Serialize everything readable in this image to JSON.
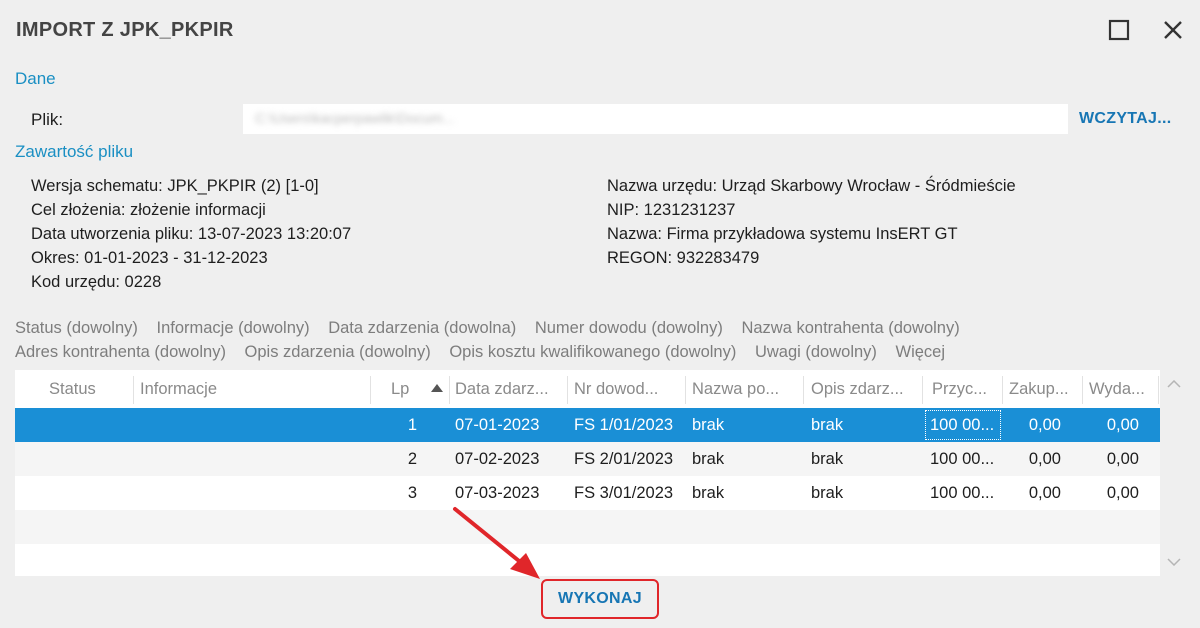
{
  "window": {
    "title": "IMPORT Z JPK_PKPIR",
    "maximize_icon": "maximize-icon",
    "close_icon": "close-icon"
  },
  "dane": {
    "section_label": "Dane",
    "plik_label": "Plik:",
    "plik_value": "C:\\Users\\kacperpawlik\\Docum...",
    "load_button": "WCZYTAJ..."
  },
  "contents": {
    "section_label": "Zawartość pliku",
    "left": [
      "Wersja schematu: JPK_PKPIR (2) [1-0]",
      "Cel złożenia: złożenie informacji",
      "Data utworzenia pliku: 13-07-2023 13:20:07",
      "Okres: 01-01-2023 - 31-12-2023",
      "Kod urzędu: 0228"
    ],
    "right": [
      "Nazwa urzędu: Urząd Skarbowy Wrocław - Śródmieście",
      "NIP: 1231231237",
      "Nazwa: Firma przykładowa systemu InsERT GT",
      "REGON: 932283479"
    ]
  },
  "filters": {
    "row1": [
      "Status (dowolny)",
      "Informacje (dowolny)",
      "Data zdarzenia (dowolna)",
      "Numer dowodu (dowolny)",
      "Nazwa kontrahenta (dowolny)"
    ],
    "row2": [
      "Adres kontrahenta (dowolny)",
      "Opis zdarzenia (dowolny)",
      "Opis kosztu kwalifikowanego (dowolny)",
      "Uwagi (dowolny)",
      "Więcej"
    ]
  },
  "grid": {
    "columns": [
      "Status",
      "Informacje",
      "Lp",
      "Data zdarz...",
      "Nr dowod...",
      "Nazwa po...",
      "Opis zdarz...",
      "Przyc...",
      "Zakup...",
      "Wyda..."
    ],
    "sort_icon": "sort-ascending-icon",
    "rows": [
      {
        "status": "",
        "info": "",
        "lp": "1",
        "data": "07-01-2023",
        "nr": "FS 1/01/2023",
        "nazwa": "brak",
        "opis": "brak",
        "przych": "100 00...",
        "zakup": "0,00",
        "wyd": "0,00",
        "selected": true
      },
      {
        "status": "",
        "info": "",
        "lp": "2",
        "data": "07-02-2023",
        "nr": "FS 2/01/2023",
        "nazwa": "brak",
        "opis": "brak",
        "przych": "100 00...",
        "zakup": "0,00",
        "wyd": "0,00",
        "selected": false
      },
      {
        "status": "",
        "info": "",
        "lp": "3",
        "data": "07-03-2023",
        "nr": "FS 3/01/2023",
        "nazwa": "brak",
        "opis": "brak",
        "przych": "100 00...",
        "zakup": "0,00",
        "wyd": "0,00",
        "selected": false
      }
    ]
  },
  "actions": {
    "execute_button": "WYKONAJ"
  },
  "colors": {
    "accent": "#1a8fd6",
    "link": "#1776b4",
    "section": "#1a8fc3",
    "highlight_border": "#e0262a"
  }
}
